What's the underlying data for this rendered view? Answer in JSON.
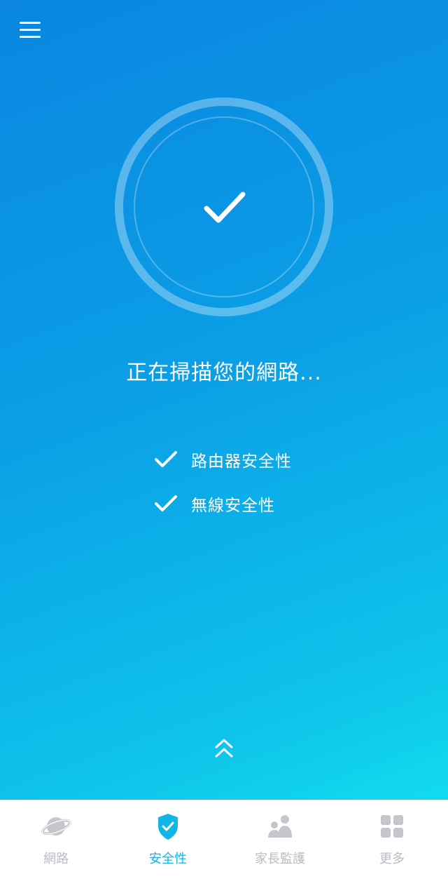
{
  "scan": {
    "title": "正在掃描您的網路...",
    "items": [
      {
        "label": "路由器安全性",
        "status": "checked"
      },
      {
        "label": "無線安全性",
        "status": "checked"
      }
    ]
  },
  "tabbar": {
    "active": "security",
    "tabs": [
      {
        "id": "network",
        "label": "網路",
        "icon": "planet-icon"
      },
      {
        "id": "security",
        "label": "安全性",
        "icon": "shield-check-icon"
      },
      {
        "id": "parental",
        "label": "家長監護",
        "icon": "family-icon"
      },
      {
        "id": "more",
        "label": "更多",
        "icon": "grid-icon"
      }
    ]
  },
  "colors": {
    "gradient_top": "#0a86e0",
    "gradient_bottom": "#12dbee",
    "accent": "#12b6e6",
    "inactive": "#b9bcc1"
  }
}
